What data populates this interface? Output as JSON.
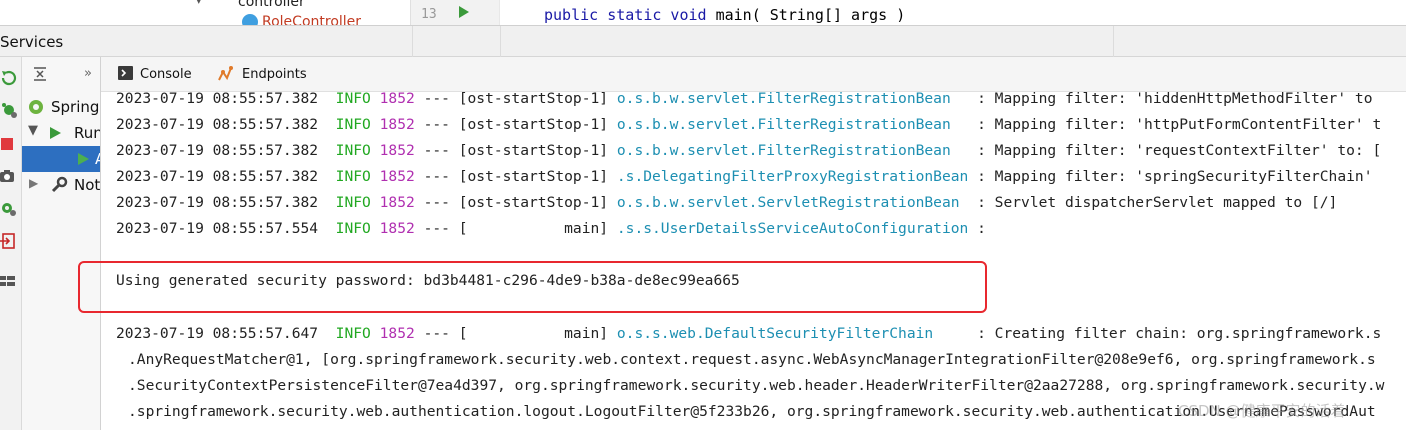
{
  "editor": {
    "tree_folder": "controller",
    "tree_class": "RoleController",
    "line_number": "13",
    "code_keywords": "public static void",
    "code_rest": " main( String[] args )"
  },
  "services": {
    "title": "Services"
  },
  "tree": {
    "items": [
      {
        "label": "Spring"
      },
      {
        "label": "Run"
      },
      {
        "label": "A"
      },
      {
        "label": "Not"
      }
    ]
  },
  "console": {
    "tabs": [
      {
        "label": "Console",
        "icon": "console-icon"
      },
      {
        "label": "Endpoints",
        "icon": "endpoints-icon"
      }
    ],
    "lines": [
      {
        "ts": "2023-07-19 08:55:57.382",
        "level": "INFO",
        "pid": "1852",
        "thread": " --- [ost-startStop-1] ",
        "logger": "o.s.b.w.servlet.FilterRegistrationBean  ",
        "msg": " : Mapping filter: 'hiddenHttpMethodFilter' to"
      },
      {
        "ts": "2023-07-19 08:55:57.382",
        "level": "INFO",
        "pid": "1852",
        "thread": " --- [ost-startStop-1] ",
        "logger": "o.s.b.w.servlet.FilterRegistrationBean  ",
        "msg": " : Mapping filter: 'httpPutFormContentFilter' t"
      },
      {
        "ts": "2023-07-19 08:55:57.382",
        "level": "INFO",
        "pid": "1852",
        "thread": " --- [ost-startStop-1] ",
        "logger": "o.s.b.w.servlet.FilterRegistrationBean  ",
        "msg": " : Mapping filter: 'requestContextFilter' to: ["
      },
      {
        "ts": "2023-07-19 08:55:57.382",
        "level": "INFO",
        "pid": "1852",
        "thread": " --- [ost-startStop-1] ",
        "logger": ".s.DelegatingFilterProxyRegistrationBean",
        "msg": " : Mapping filter: 'springSecurityFilterChain'"
      },
      {
        "ts": "2023-07-19 08:55:57.382",
        "level": "INFO",
        "pid": "1852",
        "thread": " --- [ost-startStop-1] ",
        "logger": "o.s.b.w.servlet.ServletRegistrationBean ",
        "msg": " : Servlet dispatcherServlet mapped to [/]"
      },
      {
        "ts": "2023-07-19 08:55:57.554",
        "level": "INFO",
        "pid": "1852",
        "thread": " --- [           main] ",
        "logger": ".s.s.UserDetailsServiceAutoConfiguration",
        "msg": " :"
      }
    ],
    "password_line": "Using generated security password: bd3b4481-c296-4de9-b38a-de8ec99ea665",
    "chain_line": {
      "ts": "2023-07-19 08:55:57.647",
      "level": "INFO",
      "pid": "1852",
      "thread": " --- [           main] ",
      "logger": "o.s.s.web.DefaultSecurityFilterChain    ",
      "msg": " : Creating filter chain: org.springframework.s"
    },
    "continuation": [
      ".AnyRequestMatcher@1, [org.springframework.security.web.context.request.async.WebAsyncManagerIntegrationFilter@208e9ef6, org.springframework.s",
      ".SecurityContextPersistenceFilter@7ea4d397, org.springframework.security.web.header.HeaderWriterFilter@2aa27288, org.springframework.security.w",
      ".springframework.security.web.authentication.logout.LogoutFilter@5f233b26, org.springframework.security.web.authentication.UsernamePasswordAut"
    ]
  },
  "watermark": "CSDN @健康平安的活着",
  "colors": {
    "info": "#21a821",
    "pid": "#b02fb0",
    "logger": "#1d8fb2",
    "highlight_box": "#e8282f",
    "selection": "#2d6fc0"
  }
}
